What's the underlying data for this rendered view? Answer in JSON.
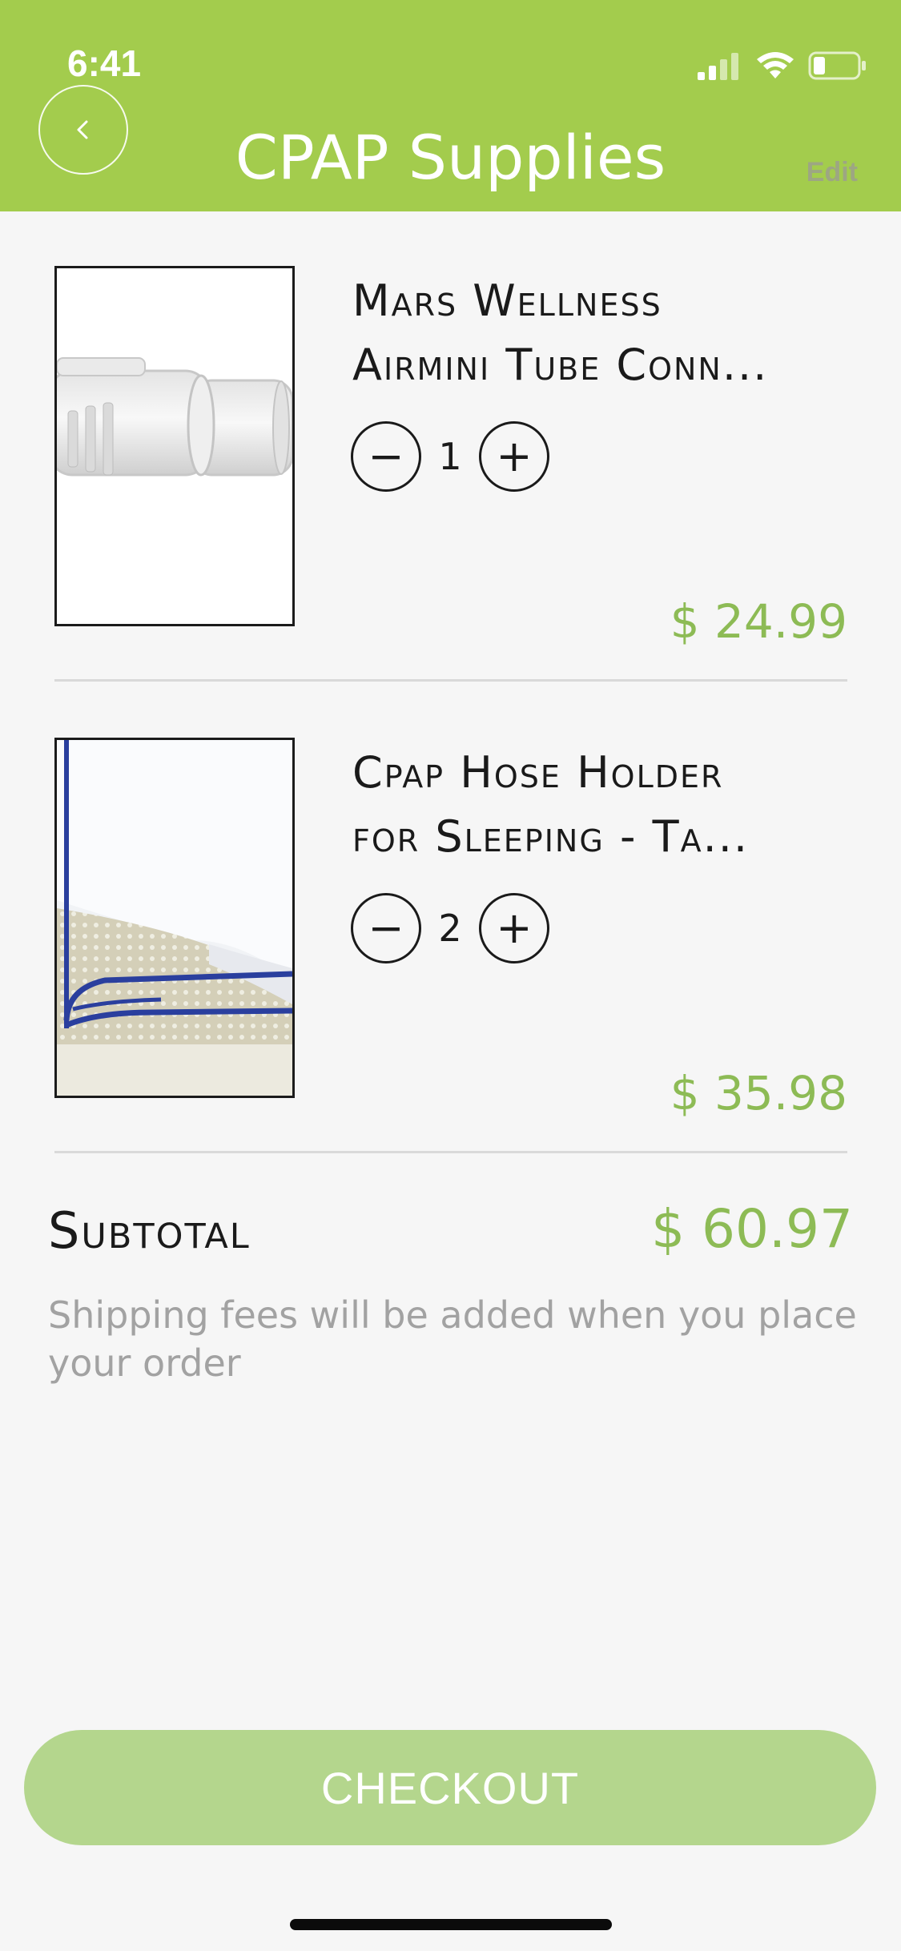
{
  "status_bar": {
    "time": "6:41"
  },
  "header": {
    "title": "CPAP Supplies",
    "edit_label": "Edit",
    "back_icon": "chevron-left-icon"
  },
  "cart": {
    "items": [
      {
        "name": "Mars Wellness\nAirmini Tube Conn...",
        "quantity": "1",
        "price": "$ 24.99",
        "decrement_label": "−",
        "increment_label": "+"
      },
      {
        "name": "Cpap Hose Holder\nfor Sleeping - Ta...",
        "quantity": "2",
        "price": "$ 35.98",
        "decrement_label": "−",
        "increment_label": "+"
      }
    ]
  },
  "summary": {
    "subtotal_label": "Subtotal",
    "subtotal_value": "$ 60.97",
    "shipping_note": "Shipping fees will be added when you place your order"
  },
  "checkout": {
    "label": "CHECKOUT"
  },
  "colors": {
    "header_background": "#a3cc4d",
    "price": "#8dbb55",
    "checkout_background": "#b4d68d",
    "page_background": "#f6f6f6"
  }
}
